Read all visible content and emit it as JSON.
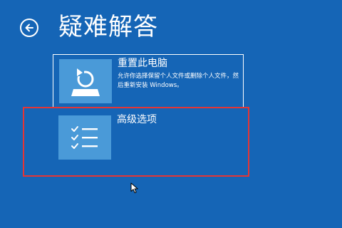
{
  "header": {
    "title": "疑难解答",
    "back_icon": "arrow-left-circle-icon"
  },
  "options": [
    {
      "title": "重置此电脑",
      "description": "允许你选择保留个人文件或删除个人文件，然后重新安装 Windows。",
      "icon": "reset-pc-icon",
      "selected": true
    },
    {
      "title": "高级选项",
      "icon": "checklist-icon",
      "selected": false
    }
  ],
  "colors": {
    "background": "#1565b6",
    "tile": "#4a9ad8",
    "highlight": "#e53535",
    "text": "#ffffff"
  }
}
